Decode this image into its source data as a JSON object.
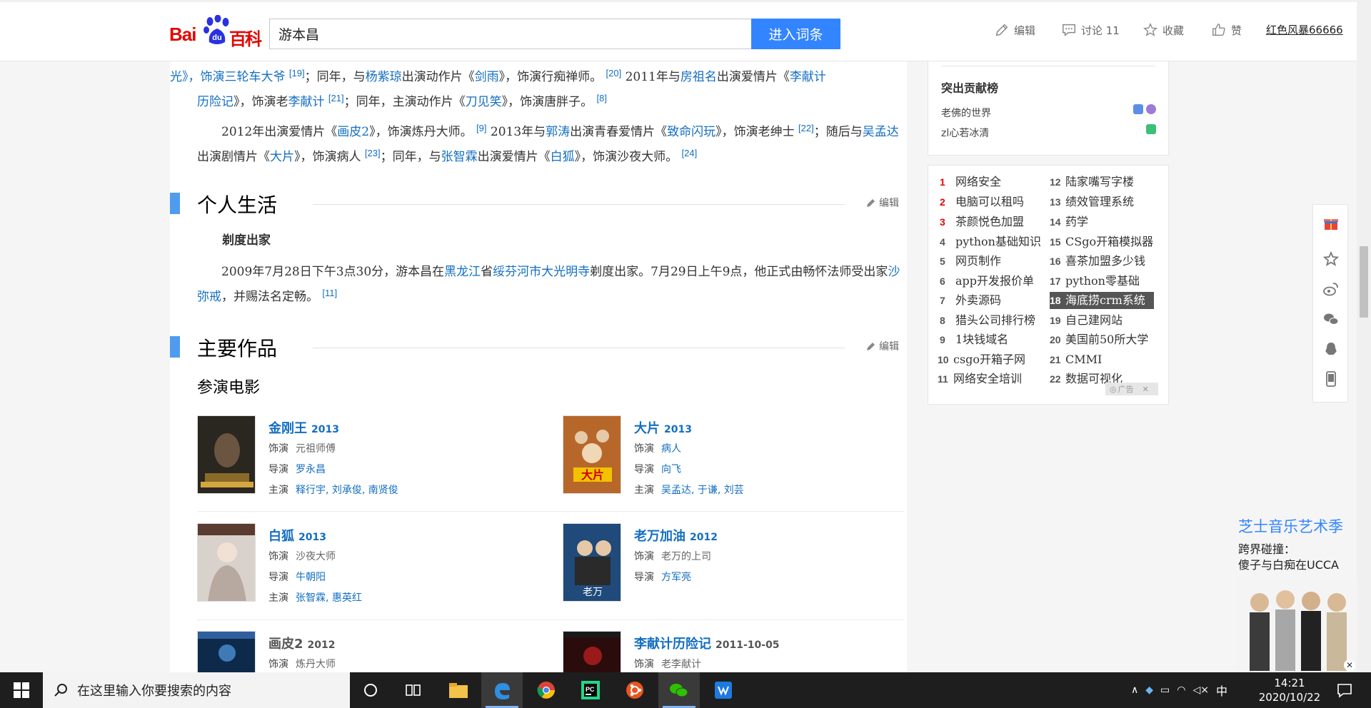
{
  "header": {
    "logo_text_1": "Bai",
    "logo_text_2": "百科",
    "search_value": "游本昌",
    "search_button": "进入词条",
    "toolbar": {
      "edit": "编辑",
      "discuss": "讨论 11",
      "favorite": "收藏",
      "like": "赞"
    },
    "username": "红色风暴66666"
  },
  "article": {
    "para1": {
      "t1": "光》，饰演三轮车大爷 ",
      "s1": "[19]",
      "t2": "；同年，与",
      "l1": "杨紫琼",
      "t3": "出演动作片《",
      "l2": "剑雨",
      "t4": "》，饰演行痴禅师。 ",
      "s2": "[20]",
      "t5": " 2011年与",
      "l3": "房祖名",
      "t6": "出演爱情片《",
      "l4": "李献计",
      "l4b": "历险记",
      "t7": "》，饰演老",
      "l5": "李献计",
      "s3": "[21]",
      "t8": "；同年，主演动作片《",
      "l6": "刀见笑",
      "t9": "》，饰演唐胖子。 ",
      "s4": "[8]"
    },
    "para2": {
      "t1": "2012年出演爱情片《",
      "l1": "画皮2",
      "t2": "》，饰演炼丹大师。 ",
      "s1": "[9]",
      "t3": " 2013年与",
      "l2": "郭涛",
      "t4": "出演青春爱情片《",
      "l3": "致命闪玩",
      "t5": "》，饰演老绅士 ",
      "s2": "[22]",
      "t6": "；随后与",
      "l4": "吴孟达",
      "t7": "出演剧情片《",
      "l5": "大片",
      "t8": "》，饰演病人 ",
      "s3": "[23]",
      "t9": "；同年，与",
      "l6": "张智霖",
      "t10": "出演爱情片《",
      "l7": "白狐",
      "t11": "》，饰演沙夜大师。 ",
      "s4": "[24]"
    },
    "section_personal": "个人生活",
    "edit_label": "编辑",
    "subsection": "剃度出家",
    "para3": {
      "t1": "2009年7月28日下午3点30分，游本昌在",
      "l1": "黑龙江",
      "t2": "省",
      "l2": "绥芬河市大光明寺",
      "t3": "剃度出家。7月29日上午9点，他正式由畅怀法师受出家",
      "l3": "沙弥戒",
      "t4": "，并赐法名定畅。 ",
      "s1": "[11]"
    },
    "section_works": "主要作品",
    "films_heading": "参演电影",
    "role_key": "饰演",
    "director_key": "导演",
    "star_key": "主演",
    "films": [
      {
        "title": "金刚王",
        "year": "2013",
        "role": "元祖师傅",
        "director": "罗永昌",
        "stars": "释行宇, 刘承俊, 南贤俊"
      },
      {
        "title": "大片",
        "year": "2013",
        "role": "病人",
        "director": "向飞",
        "stars": "吴孟达, 于谦, 刘芸"
      },
      {
        "title": "白狐",
        "year": "2013",
        "role": "沙夜大师",
        "director": "牛朝阳",
        "stars": "张智霖, 惠英红"
      },
      {
        "title": "老万加油",
        "year": "2012",
        "role": "老万的上司",
        "director": "方军亮"
      },
      {
        "title": "画皮2",
        "year": "2012",
        "role": "炼丹大师"
      },
      {
        "title": "李献计历险记",
        "year": "2011-10-05",
        "role": "老李献计"
      }
    ]
  },
  "sidebar": {
    "contrib_title": "突出贡献榜",
    "contributors": [
      "老佛的世界",
      "zl心若冰清"
    ],
    "ad_label": "广告",
    "ads": [
      {
        "n": "1",
        "text": "网络安全"
      },
      {
        "n": "2",
        "text": "电脑可以租吗"
      },
      {
        "n": "3",
        "text": "茶颜悦色加盟"
      },
      {
        "n": "4",
        "text": "python基础知识"
      },
      {
        "n": "5",
        "text": "网页制作"
      },
      {
        "n": "6",
        "text": "app开发报价单"
      },
      {
        "n": "7",
        "text": "外卖源码"
      },
      {
        "n": "8",
        "text": "猎头公司排行榜"
      },
      {
        "n": "9",
        "text": "1块钱域名"
      },
      {
        "n": "10",
        "text": "csgo开箱子网"
      },
      {
        "n": "11",
        "text": "网络安全培训"
      },
      {
        "n": "12",
        "text": "陆家嘴写字楼"
      },
      {
        "n": "13",
        "text": "绩效管理系统"
      },
      {
        "n": "14",
        "text": "药学"
      },
      {
        "n": "15",
        "text": "CSgo开箱模拟器"
      },
      {
        "n": "16",
        "text": "喜茶加盟多少钱"
      },
      {
        "n": "17",
        "text": "python零基础"
      },
      {
        "n": "18",
        "text": "海底捞crm系统"
      },
      {
        "n": "19",
        "text": "自己建网站"
      },
      {
        "n": "20",
        "text": "美国前50所大学"
      },
      {
        "n": "21",
        "text": "CMMI"
      },
      {
        "n": "22",
        "text": "数据可视化"
      }
    ]
  },
  "float_ad": {
    "line1": "芝士音乐艺术季",
    "line2": "跨界碰撞：",
    "line3": "傻子与白痴在UCCA"
  },
  "taskbar": {
    "search_placeholder": "在这里输入你要搜索的内容",
    "ime": "中",
    "time": "14:21",
    "date": "2020/10/22"
  },
  "colors": {
    "link": "#136ec2",
    "accent": "#3385ff",
    "section_bar": "#4f9cee",
    "logo_red": "#e10601"
  }
}
